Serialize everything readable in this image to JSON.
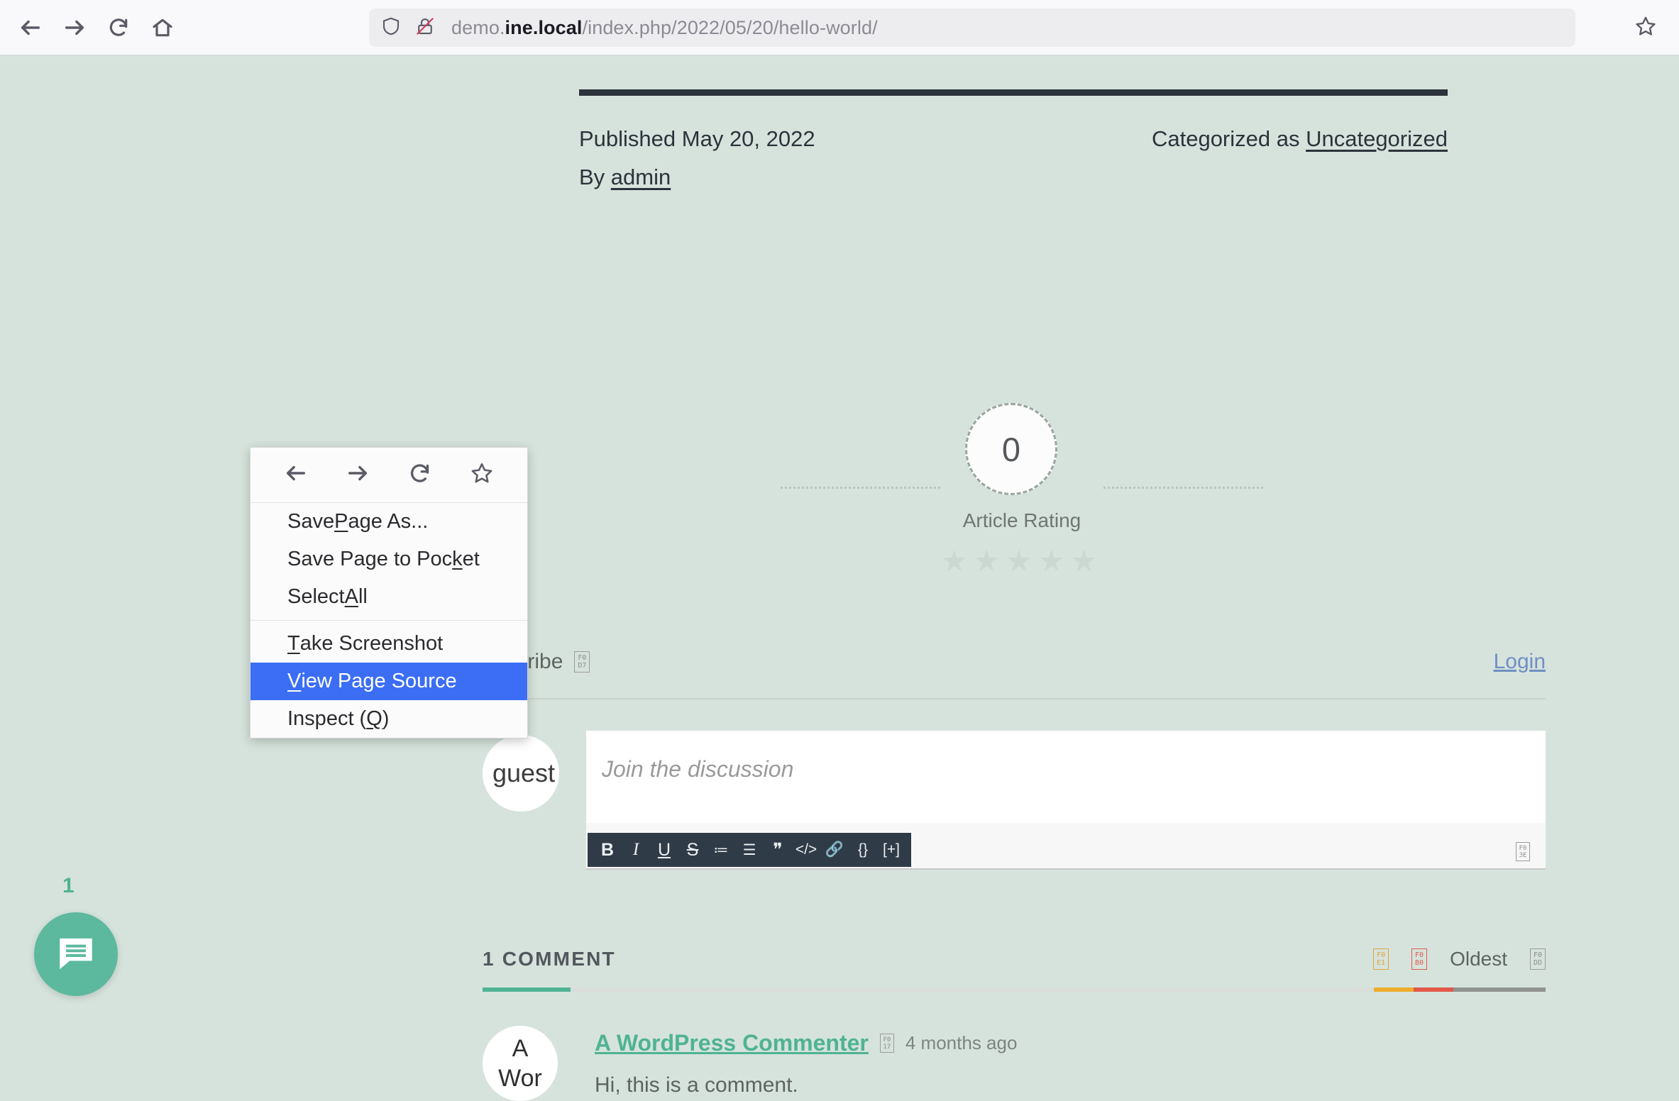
{
  "browser": {
    "back_icon": "back-arrow-icon",
    "forward_icon": "forward-arrow-icon",
    "reload_icon": "reload-icon",
    "home_icon": "home-icon",
    "shield_icon": "shield-icon",
    "insecure_lock_icon": "lock-crossed-icon",
    "bookmark_icon": "star-icon",
    "url_prefix": "demo.",
    "url_host": "ine.local",
    "url_path": "/index.php/2022/05/20/hello-world/"
  },
  "post": {
    "published": "Published May 20, 2022",
    "by_prefix": "By ",
    "author": "admin",
    "categorized_prefix": "Categorized as ",
    "category": "Uncategorized"
  },
  "rating": {
    "value": "0",
    "label": "Article Rating",
    "stars": "★★★★★"
  },
  "subscribe_bar": {
    "label": "ubscribe",
    "full_label": "Subscribe",
    "caret_glyph_top": "F0",
    "caret_glyph_bottom": "D7",
    "login": "Login"
  },
  "editor": {
    "avatar_text": "guest",
    "placeholder": "Join the discussion",
    "expand_glyph_top": "F0",
    "expand_glyph_bottom": "3E",
    "toolbar": [
      {
        "name": "bold-button",
        "label": "B",
        "style": "bold"
      },
      {
        "name": "italic-button",
        "label": "I",
        "style": "italic"
      },
      {
        "name": "underline-button",
        "label": "U",
        "style": "under"
      },
      {
        "name": "strikethrough-button",
        "label": "S",
        "style": "strike"
      },
      {
        "name": "ordered-list-button",
        "label": "≔",
        "style": "small"
      },
      {
        "name": "unordered-list-button",
        "label": "☰",
        "style": "small"
      },
      {
        "name": "blockquote-button",
        "label": "❞",
        "style": ""
      },
      {
        "name": "code-button",
        "label": "</>",
        "style": "small"
      },
      {
        "name": "link-button",
        "label": "🔗",
        "style": "small"
      },
      {
        "name": "source-code-button",
        "label": "{}",
        "style": "small"
      },
      {
        "name": "add-media-button",
        "label": "[+]",
        "style": "small"
      }
    ]
  },
  "comments": {
    "count_label": "1 COMMENT",
    "sort_label": "Oldest",
    "icon_share_top": "F0",
    "icon_share_bottom": "E1",
    "icon_sort_top": "F0",
    "icon_sort_bottom": "B0",
    "icon_caret_top": "F0",
    "icon_caret_bottom": "DD",
    "items": [
      {
        "avatar_line1": "A",
        "avatar_line2": "Wor",
        "author": "A WordPress Commenter",
        "time_glyph_top": "F0",
        "time_glyph_bottom": "17",
        "time": "4 months ago",
        "text": "Hi, this is a comment."
      }
    ]
  },
  "chat_widget": {
    "badge": "1",
    "icon": "chat-bubble-icon"
  },
  "context_menu": {
    "icons": [
      {
        "name": "menu-back-icon"
      },
      {
        "name": "menu-forward-icon"
      },
      {
        "name": "menu-reload-icon"
      },
      {
        "name": "menu-bookmark-icon"
      }
    ],
    "items": [
      {
        "name": "save-page-as",
        "pre": "Save ",
        "acc": "P",
        "post": "age As...",
        "selected": false,
        "sep_after": false
      },
      {
        "name": "save-page-to-pocket",
        "pre": "Save Page to Poc",
        "acc": "k",
        "post": "et",
        "selected": false,
        "sep_after": false
      },
      {
        "name": "select-all",
        "pre": "Select ",
        "acc": "A",
        "post": "ll",
        "selected": false,
        "sep_after": true
      },
      {
        "name": "take-screenshot",
        "pre": "",
        "acc": "T",
        "post": "ake Screenshot",
        "selected": false,
        "sep_after": false
      },
      {
        "name": "view-page-source",
        "pre": "",
        "acc": "V",
        "post": "iew Page Source",
        "selected": true,
        "sep_after": false
      },
      {
        "name": "inspect",
        "pre": "Inspect (",
        "acc": "Q",
        "post": ")",
        "selected": false,
        "sep_after": false
      }
    ]
  },
  "colors": {
    "page_bg": "#d6e3dc",
    "accent_teal": "#4fb393",
    "menu_highlight": "#3b6ef5",
    "link_blue": "#6f8fc4",
    "rule_dark": "#2c333a"
  }
}
